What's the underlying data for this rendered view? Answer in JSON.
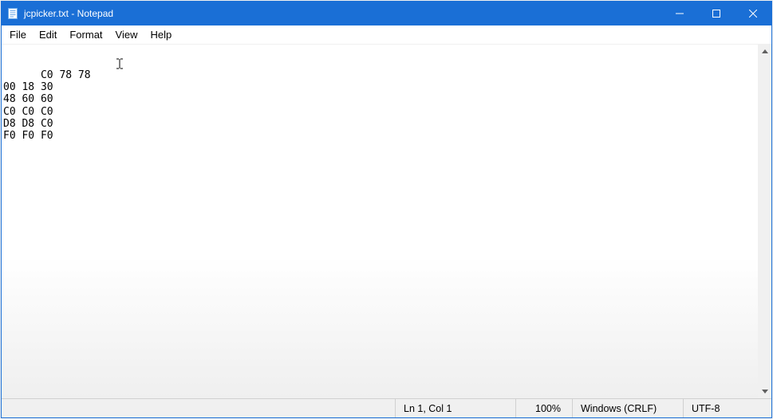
{
  "window": {
    "title": "jcpicker.txt - Notepad",
    "icon_name": "notepad-icon"
  },
  "menu": {
    "items": [
      "File",
      "Edit",
      "Format",
      "View",
      "Help"
    ]
  },
  "document": {
    "lines": [
      "C0 78 78",
      "00 18 30",
      "48 60 60",
      "C0 C0 C0",
      "D8 D8 C0",
      "F0 F0 F0"
    ]
  },
  "status": {
    "cursor": "Ln 1, Col 1",
    "zoom": "100%",
    "line_ending": "Windows (CRLF)",
    "encoding": "UTF-8"
  },
  "colors": {
    "accent": "#1a6fd6"
  }
}
